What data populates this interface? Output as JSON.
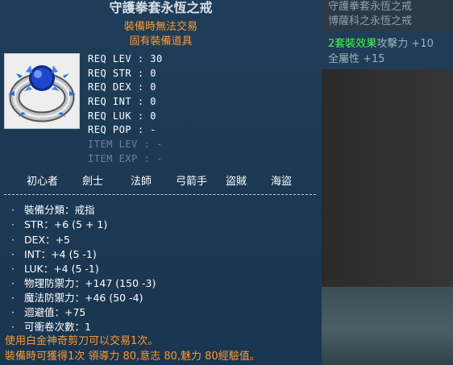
{
  "tooltip": {
    "title": "守護拳套永恆之戒",
    "trade_note": "裝備時無法交易",
    "unique_note": "固有裝備道具",
    "item_icon": "sapphire-ring-icon",
    "requirements": [
      {
        "label": "REQ LEV",
        "value": ": 30"
      },
      {
        "label": "REQ STR",
        "value": ": 0"
      },
      {
        "label": "REQ DEX",
        "value": ": 0"
      },
      {
        "label": "REQ INT",
        "value": ": 0"
      },
      {
        "label": "REQ LUK",
        "value": ": 0"
      },
      {
        "label": "REQ POP",
        "value": ": -"
      },
      {
        "label": "ITEM LEV",
        "value": ": -"
      },
      {
        "label": "ITEM EXP",
        "value": ": -"
      }
    ],
    "jobs": [
      "初心者",
      "劍士",
      "法師",
      "弓箭手",
      "盜賊",
      "海盜"
    ],
    "stats": [
      "裝備分類：戒指",
      "STR：+6 (5 + 1)",
      "DEX：+5",
      "INT：+4 (5 -1)",
      "LUK：+4 (5 -1)",
      "物理防禦力：+147 (150 -3)",
      "魔法防禦力：+46 (50 -4)",
      "迴避值：+75",
      "可衝卷次數：1"
    ],
    "footer_lines": [
      "使用白金神奇剪刀可以交易1次。",
      "裝備時可獲得1次 領導力 80,意志 80,魅力 80經驗值。"
    ],
    "colors": {
      "accent": "#ff9933",
      "set_green": "#44ff44",
      "bg": "#1f3d58"
    }
  },
  "set_panel": {
    "set_items": [
      "守護拳套永恆之戒",
      "博薩科之永恆之戒"
    ],
    "set_bonus_label": "2套裝效果",
    "set_bonus_attack": "攻擊力 +10",
    "set_bonus_all": "全屬性 +15"
  }
}
